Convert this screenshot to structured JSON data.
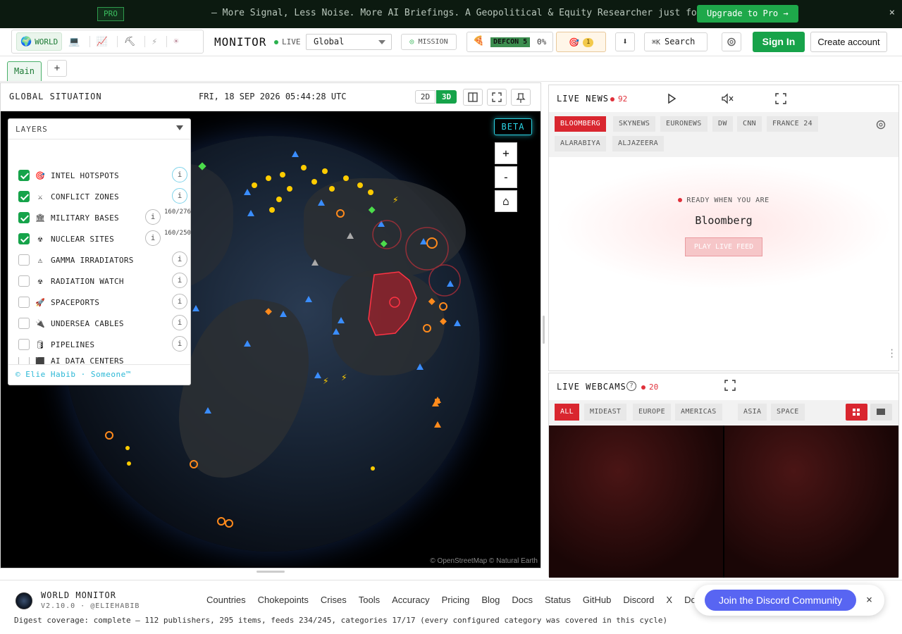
{
  "promo": {
    "tag": "PRO",
    "message": "— More Signal, Less Noise. More AI Briefings. A Geopolitical & Equity Researcher just for you.",
    "upgrade_label": "Upgrade to Pro →",
    "close": "×"
  },
  "variants": {
    "active_label": "WORLD",
    "icons": [
      "globe-icon",
      "laptop-icon",
      "chart-icon",
      "pickaxe-icon",
      "lightning-icon",
      "sun-icon"
    ]
  },
  "header": {
    "brand": "MONITOR",
    "live": "LIVE",
    "region": "Global",
    "mission": "MISSION",
    "defcon": "DEFCON 5",
    "defcon_pct": "0%",
    "alerts_count": "1",
    "search_kbd": "⌘K",
    "search_label": "Search",
    "signin": "Sign In",
    "create_account": "Create account"
  },
  "tabs": {
    "main": "Main",
    "add": "+"
  },
  "map": {
    "title": "GLOBAL SITUATION",
    "clock": "FRI, 18 SEP 2026 05:44:28 UTC",
    "mode_2d": "2D",
    "mode_3d": "3D",
    "beta": "BETA",
    "zoom_in": "+",
    "zoom_out": "-",
    "home": "⌂",
    "attribution": "© OpenStreetMap © Natural Earth"
  },
  "layers": {
    "header": "LAYERS",
    "items": [
      {
        "label": "INTEL HOTSPOTS",
        "icon": "🎯",
        "checked": true
      },
      {
        "label": "CONFLICT ZONES",
        "icon": "⚔",
        "checked": true
      },
      {
        "label": "MILITARY BASES",
        "icon": "🏛",
        "checked": true,
        "count": "160/276"
      },
      {
        "label": "NUCLEAR SITES",
        "icon": "☢",
        "checked": true,
        "count": "160/250"
      },
      {
        "label": "GAMMA IRRADIATORS",
        "icon": "⚠",
        "checked": false
      },
      {
        "label": "RADIATION WATCH",
        "icon": "☢",
        "checked": false
      },
      {
        "label": "SPACEPORTS",
        "icon": "🚀",
        "checked": false
      },
      {
        "label": "UNDERSEA CABLES",
        "icon": "🔌",
        "checked": false
      },
      {
        "label": "PIPELINES",
        "icon": "🛢",
        "checked": false
      },
      {
        "label": "AI DATA CENTERS",
        "icon": "⬛",
        "checked": false
      }
    ],
    "credit": "© Elie Habib · Someone™"
  },
  "news": {
    "title": "LIVE NEWS",
    "count": "92",
    "channels": [
      "BLOOMBERG",
      "SKYNEWS",
      "EURONEWS",
      "DW",
      "CNN",
      "FRANCE 24",
      "ALARABIYA",
      "ALJAZEERA"
    ],
    "ready": "READY WHEN YOU ARE",
    "current": "Bloomberg",
    "play": "PLAY LIVE FEED"
  },
  "webcams": {
    "title": "LIVE WEBCAMS",
    "help": "?",
    "count": "20",
    "filters": [
      "ALL",
      "MIDEAST",
      "EUROPE",
      "AMERICAS",
      "ASIA",
      "SPACE"
    ]
  },
  "footer": {
    "name": "WORLD MONITOR",
    "version": "V2.10.0 · @ELIEHABIB",
    "links": [
      "Countries",
      "Chokepoints",
      "Crises",
      "Tools",
      "Accuracy",
      "Pricing",
      "Blog",
      "Docs",
      "Status",
      "GitHub",
      "Discord",
      "X",
      "Do"
    ],
    "digest": "Digest coverage: complete — 112 publishers, 295 items, feeds 234/245, categories 17/17 (every configured category was covered in this cycle)"
  },
  "discord": {
    "label": "Join the Discord Community",
    "close": "×"
  },
  "colors": {
    "accent": "#16a34a",
    "news_red": "#d9262f",
    "discord": "#5865f2",
    "beta": "#2bd6e6"
  }
}
